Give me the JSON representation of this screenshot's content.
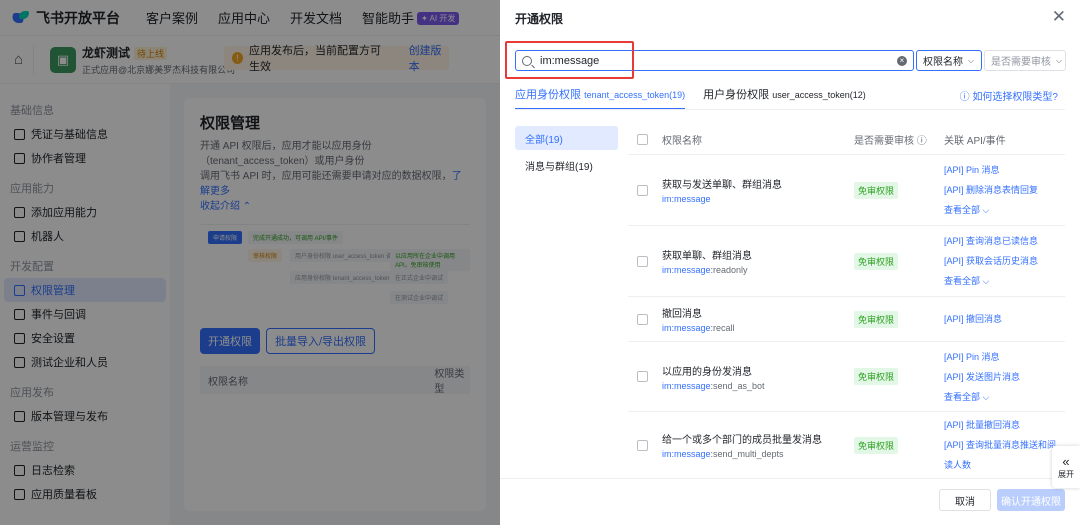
{
  "topbar": {
    "logo_text": "飞书开放平台",
    "nav": [
      "客户案例",
      "应用中心",
      "开发文档",
      "智能助手"
    ],
    "ai_badge": "✦ AI 开发"
  },
  "app": {
    "name": "龙虾测试",
    "status_tag": "待上线",
    "company": "正式应用@北京娜美罗杰科技有限公司",
    "notice": "应用发布后，当前配置方可生效",
    "notice_link": "创建版本"
  },
  "sidebar": {
    "groups": [
      {
        "title": "基础信息",
        "items": [
          "凭证与基础信息",
          "协作者管理"
        ]
      },
      {
        "title": "应用能力",
        "items": [
          "添加应用能力",
          "机器人"
        ]
      },
      {
        "title": "开发配置",
        "items": [
          "权限管理",
          "事件与回调",
          "安全设置",
          "测试企业和人员"
        ]
      },
      {
        "title": "应用发布",
        "items": [
          "版本管理与发布"
        ]
      },
      {
        "title": "运营监控",
        "items": [
          "日志检索",
          "应用质量看板"
        ]
      }
    ]
  },
  "main": {
    "title": "权限管理",
    "desc1": "开通 API 权限后，应用才能以应用身份（tenant_access_token）或用户身份",
    "desc2": "调用飞书 API 时，应用可能还需要申请对应的数据权限，",
    "learn_more": "了解更多",
    "collapse": "收起介绍 ⌃",
    "flow": [
      "申请权限",
      "审核权限",
      "完成开通成功，可调用 API/事件",
      "用户身份权限 user_access_token 调用",
      "以应用所在企业中调用 API，免审核使用",
      "应用身份权限 tenant_access_token 调用",
      "在正式企业中调试",
      "在测试企业中调试",
      "测试企业中调试"
    ],
    "btn_open": "开通权限",
    "btn_batch": "批量导入/导出权限",
    "col_name": "权限名称",
    "col_type": "权限类型"
  },
  "drawer": {
    "title": "开通权限",
    "search_value": "im:message",
    "filter_name": "权限名称",
    "filter_audit": "是否需要审核",
    "tabs": [
      {
        "label": "应用身份权限",
        "sub": "tenant_access_token(19)"
      },
      {
        "label": "用户身份权限",
        "sub": "user_access_token(12)"
      }
    ],
    "help": "如何选择权限类型?",
    "categories": [
      "全部(19)",
      "消息与群组(19)"
    ],
    "headers": {
      "name": "权限名称",
      "audit": "是否需要审核",
      "api": "关联 API/事件"
    },
    "rows": [
      {
        "name": "获取与发送单聊、群组消息",
        "key": "im:message",
        "suffix": "",
        "audit": "免审权限",
        "apis": [
          "[API] Pin 消息",
          "[API] 删除消息表情回复"
        ],
        "more": "查看全部 ⌵"
      },
      {
        "name": "获取单聊、群组消息",
        "key": "im:message",
        "suffix": ":readonly",
        "audit": "免审权限",
        "apis": [
          "[API] 查询消息已读信息",
          "[API] 获取会话历史消息"
        ],
        "more": "查看全部 ⌵"
      },
      {
        "name": "撤回消息",
        "key": "im:message",
        "suffix": ":recall",
        "audit": "免审权限",
        "apis": [
          "[API] 撤回消息"
        ],
        "more": ""
      },
      {
        "name": "以应用的身份发消息",
        "key": "im:message",
        "suffix": ":send_as_bot",
        "audit": "免审权限",
        "apis": [
          "[API] Pin 消息",
          "[API] 发送图片消息"
        ],
        "more": "查看全部 ⌵"
      },
      {
        "name": "给一个或多个部门的成员批量发消息",
        "key": "im:message",
        "suffix": ":send_multi_depts",
        "audit": "免审权限",
        "apis": [
          "[API] 批量撤回消息",
          "[API] 查询批量消息推送和阅",
          "读人数"
        ],
        "more": ""
      }
    ],
    "cancel": "取消",
    "confirm": "确认开通权限",
    "expand": "展开"
  }
}
